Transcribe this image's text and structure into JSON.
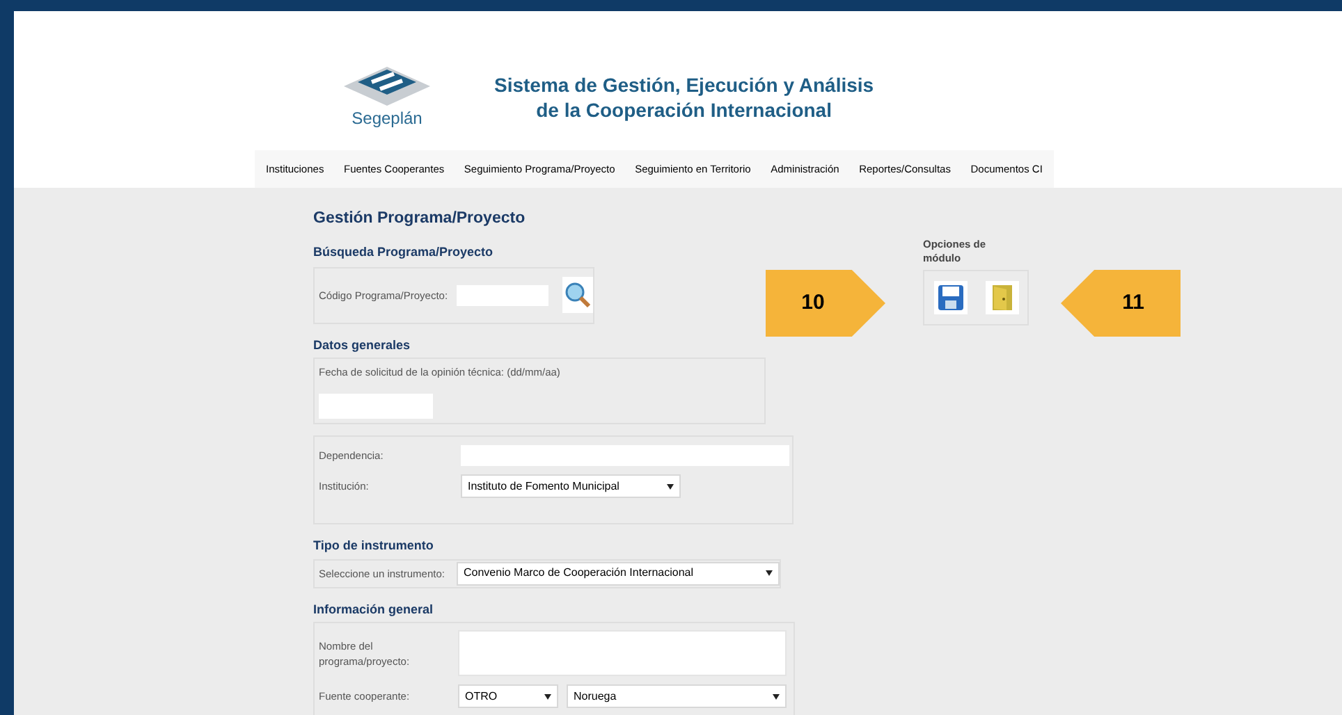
{
  "header": {
    "logo_text": "Segeplán",
    "title_lines": [
      "Sistema de Gestión, Ejecución y Análisis",
      "de la Cooperación Internacional"
    ]
  },
  "nav": [
    "Instituciones",
    "Fuentes Cooperantes",
    "Seguimiento Programa/Proyecto",
    "Seguimiento en Territorio",
    "Administración",
    "Reportes/Consultas",
    "Documentos CI"
  ],
  "page_title": "Gestión Programa/Proyecto",
  "search": {
    "heading": "Búsqueda Programa/Proyecto",
    "label": "Código Programa/Proyecto:"
  },
  "general": {
    "heading": "Datos generales",
    "date_label": "Fecha de solicitud de la opinión técnica: (dd/mm/aa)",
    "dependencia_label": "Dependencia:",
    "institucion_label": "Institución:",
    "institucion_value": "Instituto de Fomento Municipal"
  },
  "instrument": {
    "heading": "Tipo de instrumento",
    "label": "Seleccione un instrumento:",
    "value": "Convenio Marco de Cooperación Internacional"
  },
  "info": {
    "heading": "Información general",
    "name_label": "Nombre del programa/proyecto:",
    "source_label": "Fuente cooperante:",
    "source_type": "OTRO",
    "source_country": "Noruega"
  },
  "module_options": {
    "title": "Opciones de módulo"
  },
  "callouts": [
    {
      "number": "10",
      "kind": "pointer_right"
    },
    {
      "number": "11",
      "kind": "pointer_left"
    }
  ]
}
